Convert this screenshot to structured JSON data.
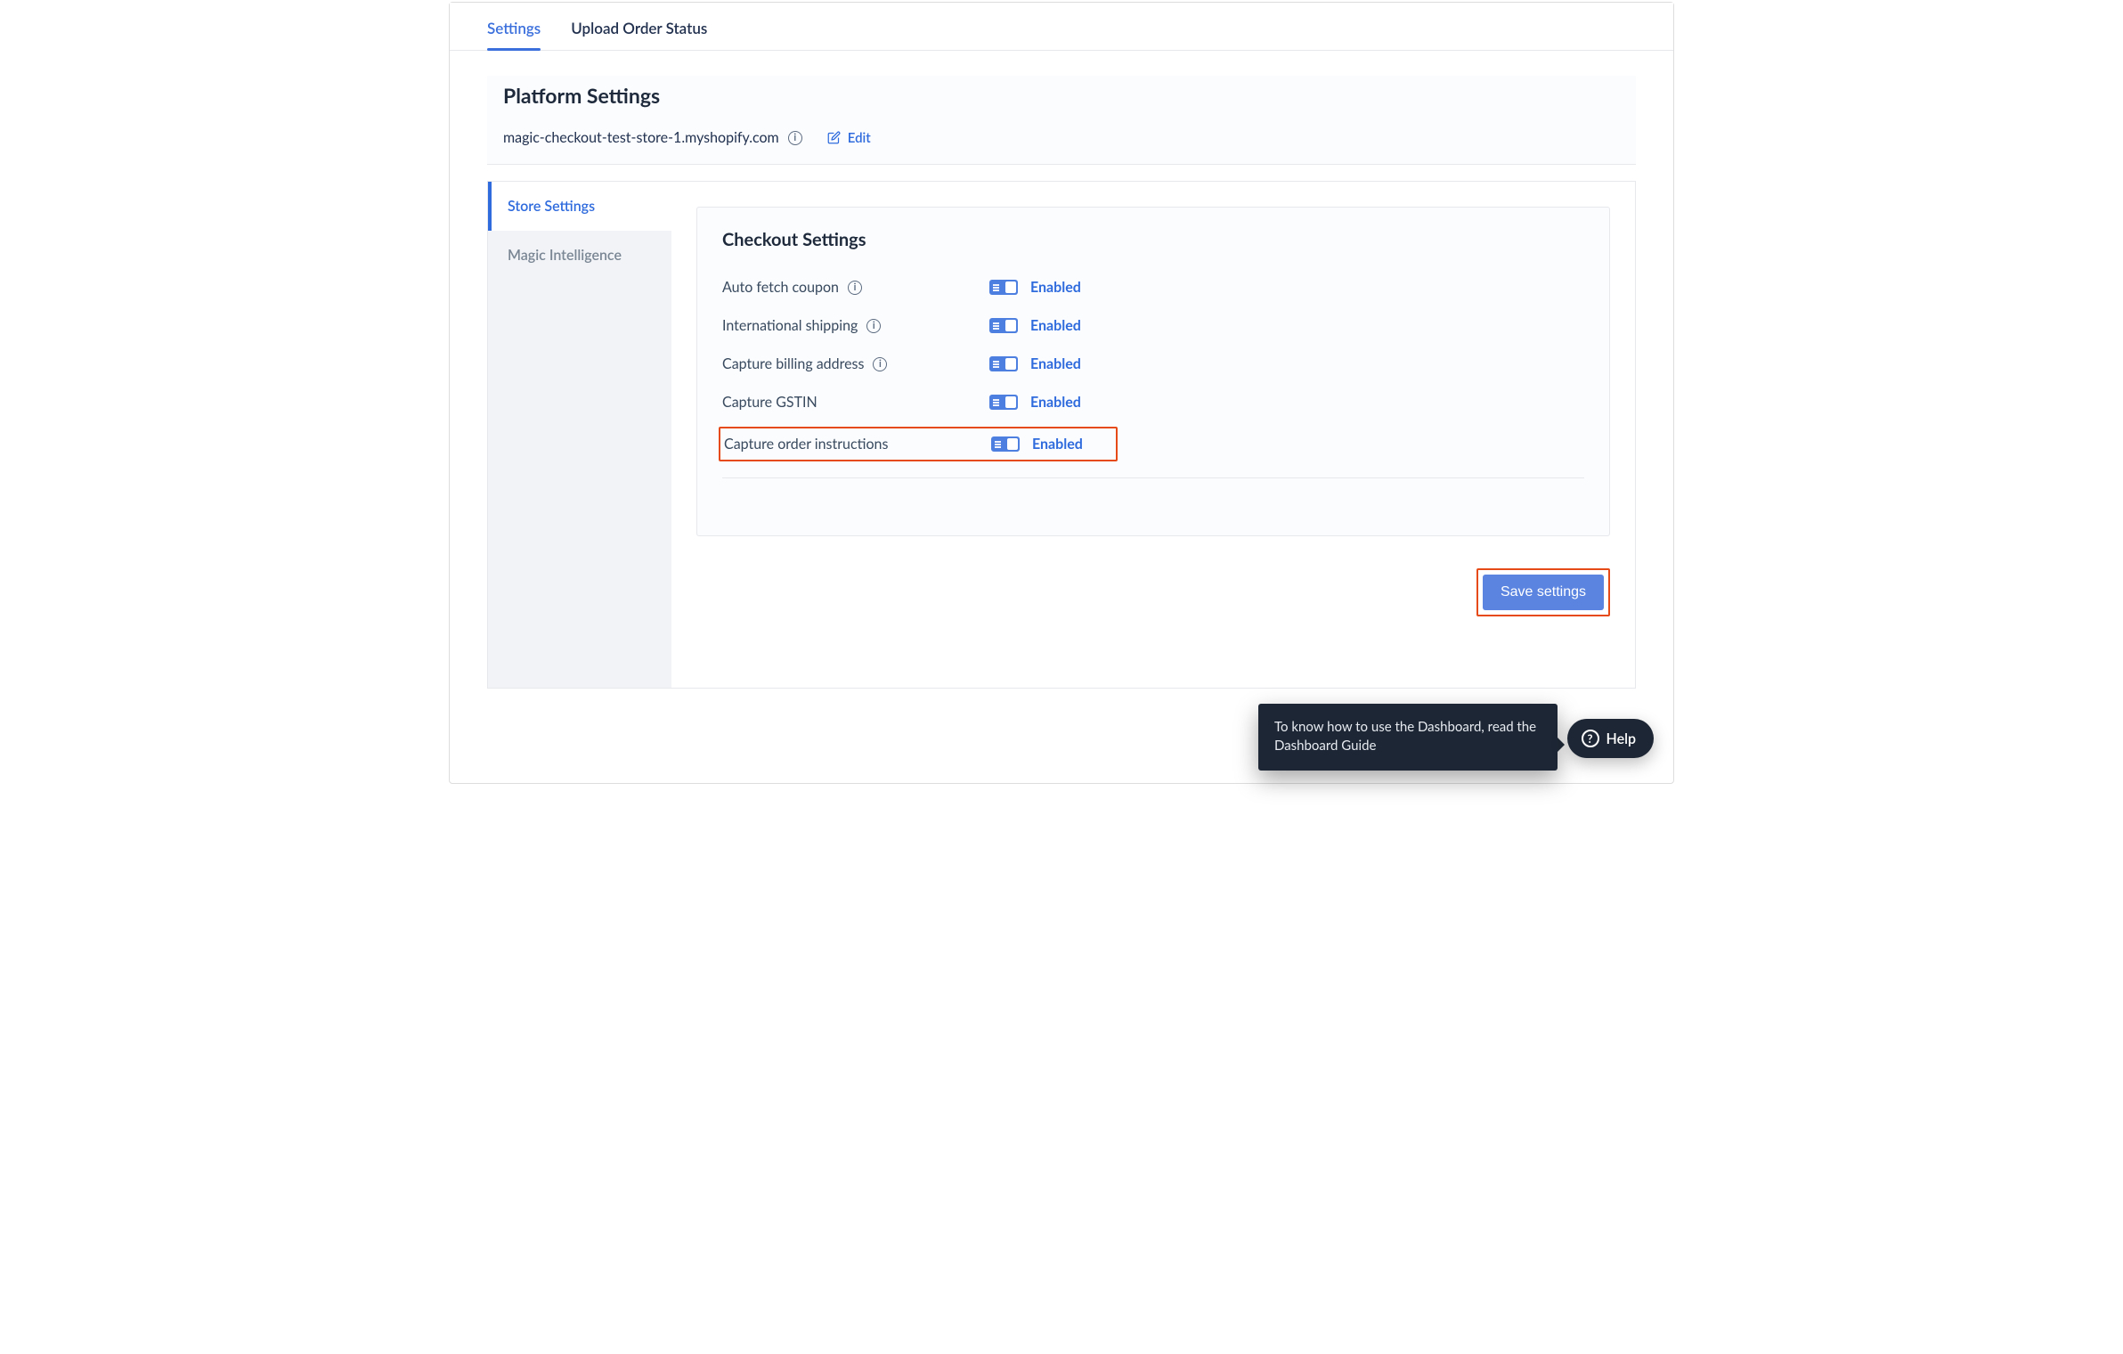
{
  "tabs": {
    "settings": "Settings",
    "upload": "Upload Order Status"
  },
  "header": {
    "title": "Platform Settings",
    "store_url": "magic-checkout-test-store-1.myshopify.com",
    "edit_label": "Edit"
  },
  "sidebar": {
    "items": [
      {
        "label": "Store Settings"
      },
      {
        "label": "Magic Intelligence"
      }
    ]
  },
  "panel": {
    "title": "Checkout Settings",
    "rows": [
      {
        "label": "Auto fetch coupon",
        "info": true,
        "status": "Enabled"
      },
      {
        "label": "International shipping",
        "info": true,
        "status": "Enabled"
      },
      {
        "label": "Capture billing address",
        "info": true,
        "status": "Enabled"
      },
      {
        "label": "Capture GSTIN",
        "info": false,
        "status": "Enabled"
      },
      {
        "label": "Capture order instructions",
        "info": false,
        "status": "Enabled"
      }
    ]
  },
  "save_label": "Save settings",
  "tooltip_text": "To know how to use the Dashboard, read the Dashboard Guide",
  "help_label": "Help"
}
